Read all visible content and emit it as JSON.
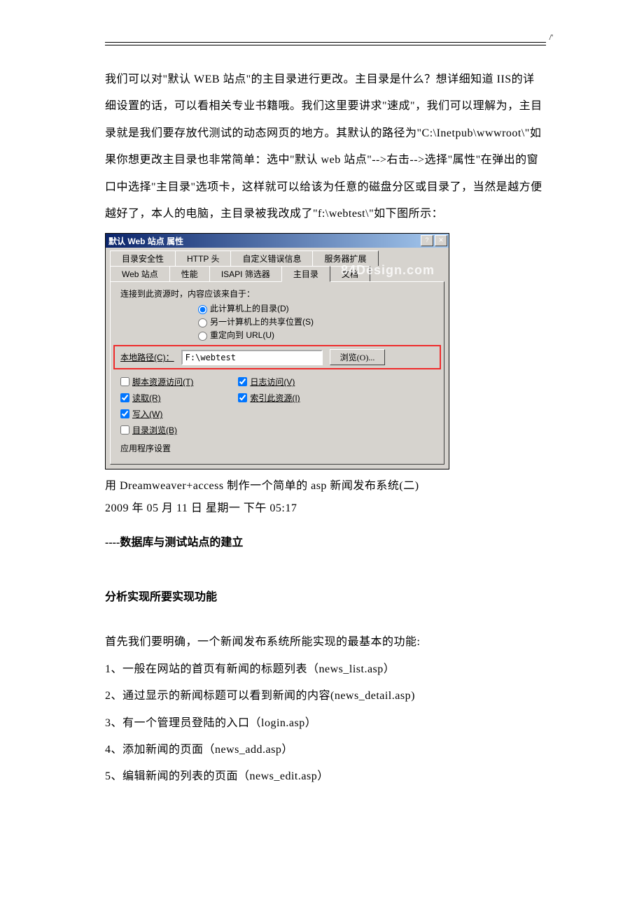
{
  "page_mark": "/'",
  "para1": "我们可以对\"默认 WEB 站点\"的主目录进行更改。主目录是什么？想详细知道 IIS的详细设置的话，可以看相关专业书籍哦。我们这里要讲求\"速成\"，我们可以理解为，主目录就是我们要存放代测试的动态网页的地方。其默认的路径为\"C:\\Inetpub\\wwwroot\\\"如果你想更改主目录也非常简单：选中\"默认 web 站点\"-->右击-->选择\"属性\"在弹出的窗口中选择\"主目录\"选项卡，这样就可以给该为任意的磁盘分区或目录了，当然是越方便越好了，本人的电脑，主目录被我改成了\"f:\\webtest\\\"如下图所示：",
  "dialog": {
    "title": "默认 Web 站点 属性",
    "help": "?",
    "close": "✕",
    "watermark": "84Design.com",
    "tabs_row1": [
      "目录安全性",
      "HTTP 头",
      "自定义错误信息",
      "服务器扩展"
    ],
    "tabs_row2": [
      "Web 站点",
      "性能",
      "ISAPI 筛选器",
      "主目录",
      "文档"
    ],
    "group_label": "连接到此资源时，内容应该来自于：",
    "radios": [
      {
        "label": "此计算机上的目录(D)",
        "checked": true
      },
      {
        "label": "另一计算机上的共享位置(S)",
        "checked": false
      },
      {
        "label": "重定向到 URL(U)",
        "checked": false
      }
    ],
    "path_label": "本地路径(C)：",
    "path_value": "F:\\webtest",
    "browse": "浏览(O)...",
    "checks_left": [
      {
        "label": "脚本资源访问(T)",
        "checked": false
      },
      {
        "label": "读取(R)",
        "checked": true
      },
      {
        "label": "写入(W)",
        "checked": true
      },
      {
        "label": "目录浏览(B)",
        "checked": false
      }
    ],
    "checks_right": [
      {
        "label": "日志访问(V)",
        "checked": true
      },
      {
        "label": "索引此资源(I)",
        "checked": true
      }
    ],
    "app_settings": "应用程序设置"
  },
  "caption_line1": "用 Dreamweaver+access 制作一个简单的 asp 新闻发布系统(二)",
  "caption_line2": "2009 年 05 月 11 日 星期一 下午 05:17",
  "section1": "----数据库与测试站点的建立",
  "section2": "分析实现所要实现功能",
  "intro": "首先我们要明确，一个新闻发布系统所能实现的最基本的功能:",
  "items": [
    "1、一般在网站的首页有新闻的标题列表（news_list.asp）",
    "2、通过显示的新闻标题可以看到新闻的内容(news_detail.asp)",
    "3、有一个管理员登陆的入口（login.asp）",
    "4、添加新闻的页面（news_add.asp）",
    "5、编辑新闻的列表的页面（news_edit.asp）"
  ]
}
